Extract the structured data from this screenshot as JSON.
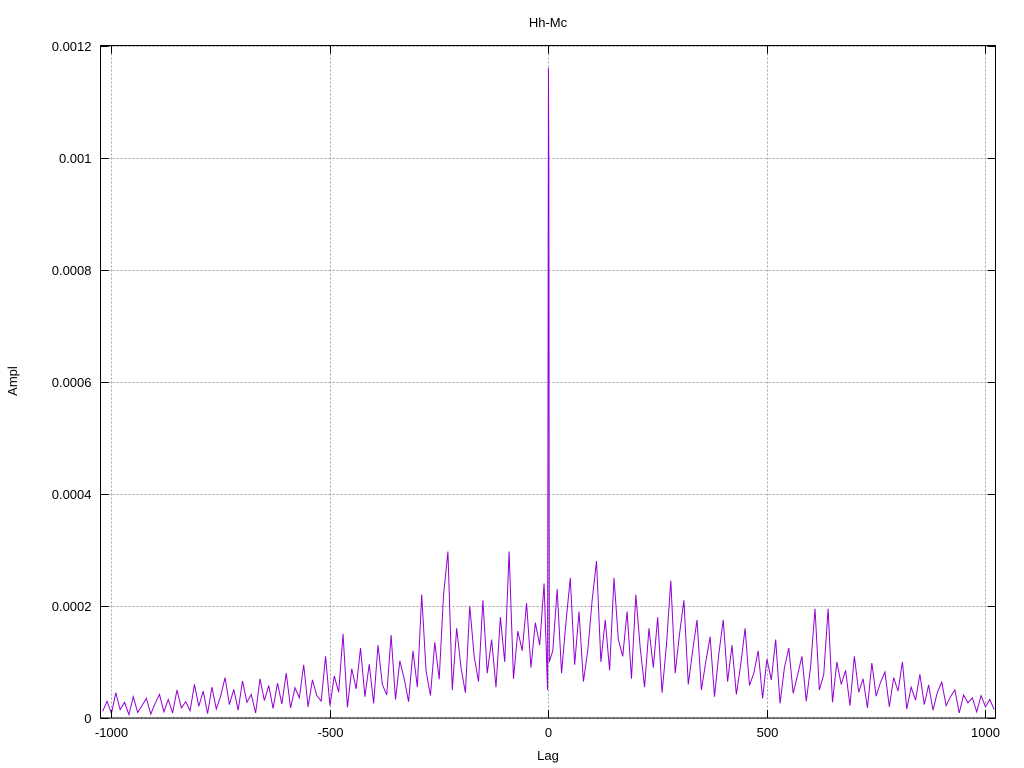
{
  "chart_data": {
    "type": "line",
    "title": "Hh-Mc",
    "xlabel": "Lag",
    "ylabel": "Ampl",
    "xlim": [
      -1025,
      1023
    ],
    "ylim": [
      0,
      0.0012
    ],
    "grid": true,
    "legend": "none",
    "x_ticks": [
      -1000,
      -500,
      0,
      500,
      1000
    ],
    "x_tick_labels": [
      "-1000",
      "-500",
      "0",
      "500",
      "1000"
    ],
    "y_ticks": [
      0,
      0.0002,
      0.0004,
      0.0006,
      0.0008,
      0.001,
      0.0012
    ],
    "y_tick_labels": [
      "0",
      "0.0002",
      "0.0004",
      "0.0006",
      "0.0008",
      "0.001",
      "0.0012"
    ],
    "series": [
      {
        "name": "Hh-Mc",
        "color": "#9400d3",
        "y_unit_multiplier": 1e-05,
        "x_start": -1020,
        "x_step": 10,
        "values": [
          1.2,
          3.0,
          0.8,
          4.5,
          1.5,
          2.8,
          0.6,
          3.8,
          1.0,
          2.2,
          3.5,
          0.7,
          2.6,
          4.2,
          1.1,
          3.3,
          0.9,
          5.0,
          1.8,
          2.9,
          1.3,
          6.0,
          2.1,
          4.8,
          0.8,
          5.5,
          1.6,
          3.9,
          7.2,
          2.4,
          5.1,
          1.4,
          6.6,
          2.8,
          4.2,
          0.9,
          7.0,
          3.1,
          5.8,
          1.7,
          6.2,
          2.5,
          8.0,
          1.8,
          5.4,
          3.6,
          9.5,
          2.0,
          6.8,
          4.0,
          3.0,
          11.0,
          2.2,
          7.5,
          4.6,
          15.0,
          1.9,
          8.8,
          5.2,
          12.5,
          3.8,
          9.6,
          2.6,
          13.0,
          6.0,
          4.1,
          14.8,
          3.3,
          10.2,
          7.0,
          2.9,
          12.0,
          5.5,
          22.0,
          8.4,
          4.0,
          13.5,
          6.9,
          22.0,
          29.7,
          5.0,
          16.0,
          9.0,
          4.5,
          20.0,
          11.0,
          6.5,
          21.0,
          8.0,
          14.0,
          5.5,
          18.0,
          10.0,
          29.7,
          7.0,
          15.5,
          12.0,
          20.5,
          9.0,
          17.0,
          13.0,
          24.0,
          116,
          12.0,
          23.0,
          8.0,
          17.0,
          25.0,
          9.5,
          19.0,
          6.5,
          12.0,
          21.0,
          28.0,
          10.0,
          17.5,
          8.5,
          25.0,
          14.0,
          11.0,
          19.0,
          7.0,
          22.0,
          12.5,
          5.5,
          16.0,
          9.0,
          18.0,
          4.5,
          13.0,
          24.5,
          8.0,
          15.0,
          21.0,
          6.0,
          12.0,
          17.5,
          5.0,
          10.0,
          14.5,
          3.8,
          11.5,
          17.5,
          6.5,
          13.0,
          4.2,
          9.5,
          16.0,
          5.8,
          8.0,
          12.0,
          3.5,
          10.5,
          6.8,
          14.0,
          2.6,
          9.0,
          12.5,
          4.4,
          7.6,
          11.0,
          3.0,
          9.2,
          19.5,
          5.0,
          7.8,
          19.5,
          2.8,
          10.0,
          6.0,
          8.5,
          2.2,
          11.0,
          4.6,
          7.0,
          1.8,
          9.8,
          3.9,
          6.4,
          8.2,
          2.0,
          7.2,
          4.8,
          10.0,
          1.6,
          5.5,
          3.2,
          7.8,
          2.4,
          5.9,
          1.4,
          4.6,
          6.4,
          2.2,
          3.8,
          5.0,
          0.9,
          4.1,
          2.7,
          3.6,
          1.1,
          4.0,
          2.0,
          3.3,
          1.5
        ],
        "extra_points": [
          [
            -2,
            5.0
          ],
          [
            -1,
            57.0
          ],
          [
            0,
            116.0
          ],
          [
            1,
            98.0
          ],
          [
            2,
            10.0
          ]
        ]
      }
    ]
  }
}
